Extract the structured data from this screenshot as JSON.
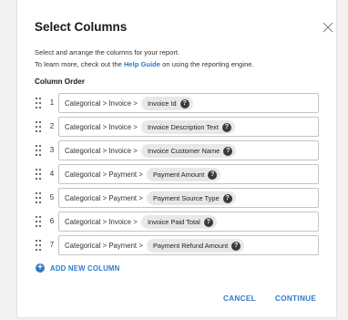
{
  "dialog": {
    "title": "Select Columns",
    "description_line1": "Select and arrange the columns for your report.",
    "description_line2_prefix": "To learn more, check out the ",
    "help_link_text": "Help Guide",
    "description_line2_suffix": " on using the reporting engine.",
    "section_label": "Column Order",
    "add_column_label": "ADD NEW COLUMN",
    "cancel_label": "CANCEL",
    "continue_label": "CONTINUE",
    "help_icon_glyph": "?",
    "add_icon_glyph": "+"
  },
  "columns": [
    {
      "index": "1",
      "path": "Categorical > Invoice >",
      "field": "Invoice Id"
    },
    {
      "index": "2",
      "path": "Categorical > Invoice >",
      "field": "Invoice Description Text"
    },
    {
      "index": "3",
      "path": "Categorical > Invoice >",
      "field": "Invoice Customer Name"
    },
    {
      "index": "4",
      "path": "Categorical > Payment >",
      "field": "Payment Amount"
    },
    {
      "index": "5",
      "path": "Categorical > Payment >",
      "field": "Payment Source Type"
    },
    {
      "index": "6",
      "path": "Categorical > Invoice >",
      "field": "Invoice Paid Total"
    },
    {
      "index": "7",
      "path": "Categorical > Payment >",
      "field": "Payment Refund Amount"
    }
  ],
  "colors": {
    "accent": "#2f7bc9",
    "chip_background": "#e8e8e8",
    "field_border": "#bfc4c9"
  },
  "icons": {
    "close": "close-icon",
    "drag": "drag-handle-icon",
    "remove": "remove-icon",
    "help": "help-icon",
    "add": "add-circle-icon"
  }
}
